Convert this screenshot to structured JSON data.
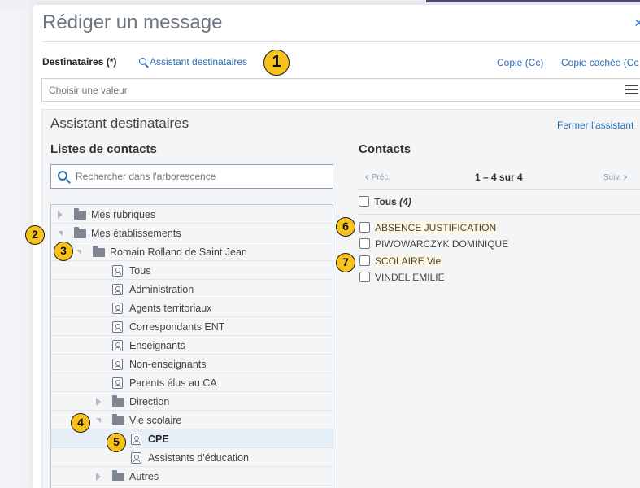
{
  "modal": {
    "title": "Rédiger un message",
    "close_symbol": "×"
  },
  "recipients": {
    "label": "Destinataires (*)",
    "assistant_link": "Assistant destinataires",
    "cc_link": "Copie (Cc)",
    "bcc_link": "Copie cachée (Cc",
    "input_placeholder": "Choisir une valeur"
  },
  "assistant": {
    "title": "Assistant destinataires",
    "close_link": "Fermer l'assistant",
    "lists": {
      "heading": "Listes de contacts",
      "search_placeholder": "Rechercher dans l'arborescence",
      "tree": [
        {
          "label": "Mes rubriques"
        },
        {
          "label": "Mes établissements"
        },
        {
          "label": "Romain Rolland de Saint Jean"
        },
        {
          "label": "Tous"
        },
        {
          "label": "Administration"
        },
        {
          "label": "Agents territoriaux"
        },
        {
          "label": "Correspondants ENT"
        },
        {
          "label": "Enseignants"
        },
        {
          "label": "Non-enseignants"
        },
        {
          "label": "Parents élus au CA"
        },
        {
          "label": "Direction"
        },
        {
          "label": "Vie scolaire"
        },
        {
          "label": "CPE"
        },
        {
          "label": "Assistants d'éducation"
        },
        {
          "label": "Autres"
        }
      ]
    },
    "contacts": {
      "heading": "Contacts",
      "prev": "Préc.",
      "count": "1 – 4 sur 4",
      "next": "Suiv.",
      "all_label": "Tous",
      "all_count": "(4)",
      "items": [
        {
          "name": "ABSENCE JUSTIFICATION"
        },
        {
          "name": "PIWOWARCZYK DOMINIQUE"
        },
        {
          "name": "SCOLAIRE Vie"
        },
        {
          "name": "VINDEL EMILIE"
        }
      ]
    }
  },
  "badges": [
    "1",
    "2",
    "3",
    "4",
    "5",
    "6",
    "7"
  ],
  "colors": {
    "link": "#2a6db5",
    "badge": "#f7c31a",
    "selected_row": "#e6eef8"
  }
}
